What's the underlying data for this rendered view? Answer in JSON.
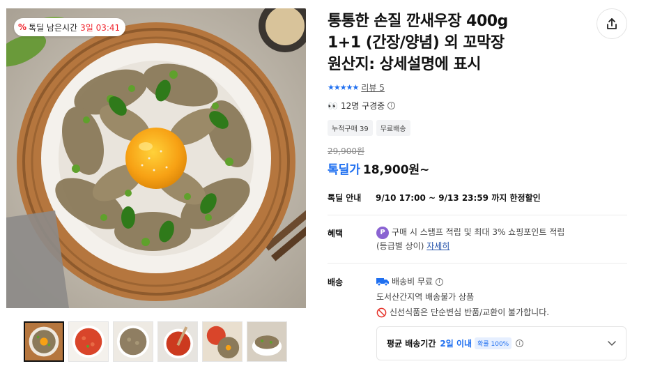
{
  "badge": {
    "label": "톡딜 남은시간",
    "timer": "3일 03:41"
  },
  "product": {
    "title_lines": [
      "통통한 손질 깐새우장 400g",
      "1+1 (간장/양념) 외 꼬막장",
      "원산지: 상세설명에 표시"
    ],
    "rating_stars": "★★★★★",
    "review_text": "리뷰 5",
    "viewers_text": "12명 구경중",
    "tags": [
      "누적구매 39",
      "무료배송"
    ],
    "original_price": "29,900원",
    "price_label": "톡딜가",
    "price": "18,900원~",
    "deal_info_label": "톡딜 안내",
    "deal_info_value": "9/10 17:00 ~ 9/13 23:59 까지 한정할인"
  },
  "benefit": {
    "label": "혜택",
    "line1": "구매 시 스탬프 적립 및 최대 3% 쇼핑포인트 적립",
    "line2_prefix": "(등급별 상이) ",
    "detail_link": "자세히"
  },
  "shipping": {
    "label": "배송",
    "fee": "배송비 무료",
    "region": "도서산간지역 배송불가 상품",
    "notice": "신선식품은 단순변심 반품/교환이 불가합니다."
  },
  "delivery": {
    "label": "평균 배송기간",
    "value": "2일 이내",
    "probability": "확률 100%"
  },
  "thumbnails": [
    "thumb-1",
    "thumb-2",
    "thumb-3",
    "thumb-4",
    "thumb-5",
    "thumb-6"
  ],
  "icons": {
    "share": "share-icon",
    "info": "info-icon",
    "truck": "truck-icon",
    "prohibit": "prohibit-icon",
    "chevron": "chevron-down-icon"
  },
  "colors": {
    "accent_blue": "#1f6ff0",
    "deal_red": "#f0252d",
    "point_purple": "#8a63d2"
  }
}
